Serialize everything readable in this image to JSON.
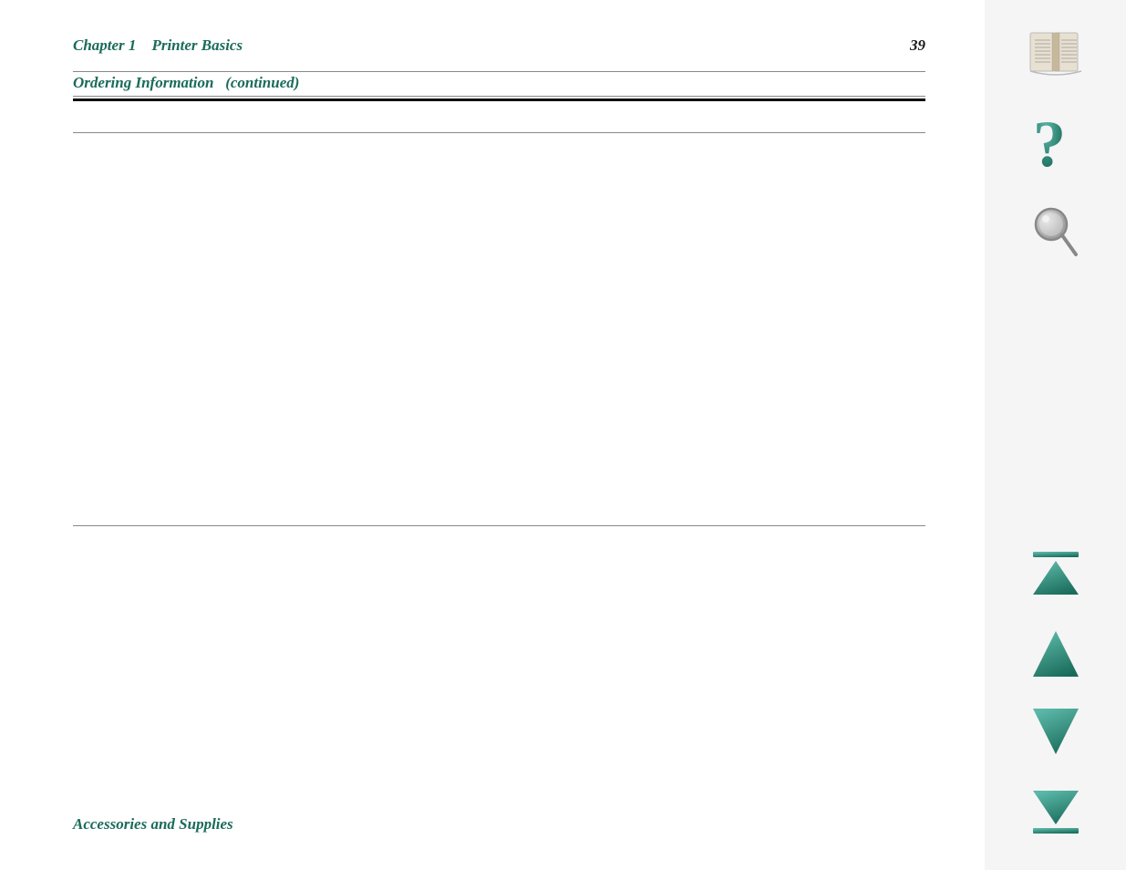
{
  "header": {
    "chapter_label": "Chapter 1",
    "chapter_title": "Printer Basics",
    "page_number": "39"
  },
  "section": {
    "title": "Ordering Information",
    "subtitle": "(continued)"
  },
  "footer": {
    "title": "Accessories and Supplies"
  },
  "sidebar": {
    "icons": [
      {
        "name": "book-icon",
        "label": "Table of Contents"
      },
      {
        "name": "help-icon",
        "label": "Help"
      },
      {
        "name": "search-icon",
        "label": "Search"
      },
      {
        "name": "first-page-icon",
        "label": "First Page"
      },
      {
        "name": "previous-page-icon",
        "label": "Previous Page"
      },
      {
        "name": "next-page-icon",
        "label": "Next Page"
      },
      {
        "name": "last-page-icon",
        "label": "Last Page"
      }
    ]
  }
}
